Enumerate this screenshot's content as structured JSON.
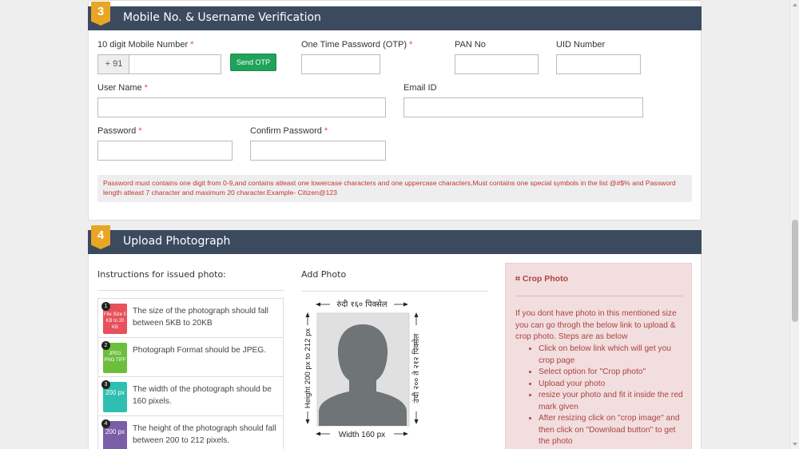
{
  "section3": {
    "number": "3",
    "title": "Mobile No. & Username Verification",
    "mobile_label": "10 digit Mobile Number",
    "mobile_prefix": "+ 91",
    "mobile_value": "",
    "send_otp_label": "Send OTP",
    "otp_label": "One Time Password (OTP)",
    "otp_value": "",
    "pan_label": "PAN No",
    "pan_value": "",
    "uid_label": "UID Number",
    "uid_value": "",
    "username_label": "User Name",
    "username_value": "",
    "email_label": "Email ID",
    "email_value": "",
    "password_label": "Password",
    "password_value": "",
    "confirm_label": "Confirm Password",
    "confirm_value": "",
    "required_mark": "*",
    "password_note": "Password must contains one digit from 0-9,and contains atleast one lowercase characters and one uppercase characters,Must contains one special symbols in the list @#$% and Password length atleast 7 character and maximum 20 character.Example- Citizen@123"
  },
  "section4": {
    "number": "4",
    "title": "Upload Photograph",
    "instructions_heading": "Instructions for issued photo:",
    "add_photo_heading": "Add Photo",
    "instructions": [
      {
        "num": "1",
        "icon": "file-size-icon",
        "icon_text": "File Size 5 KB to 20 KB",
        "color": "#e8505b",
        "text": "The size of the photograph should fall between 5KB to 20KB"
      },
      {
        "num": "2",
        "icon": "file-format-icon",
        "icon_text": "JPEG PNG TIFF",
        "color": "#6cbf3c",
        "text": "Photograph Format should be JPEG."
      },
      {
        "num": "3",
        "icon": "width-icon",
        "icon_text": "200 px",
        "color": "#2fbfb0",
        "text": "The width of the photograph should be 160 pixels."
      },
      {
        "num": "4",
        "icon": "height-icon",
        "icon_text": "200 px",
        "color": "#7b5ea8",
        "text": "The height of the photograph should fall between 200 to 212 pixels."
      }
    ],
    "photo_sample": {
      "top_label": "रुंदी १६० पिक्सेल",
      "bottom_label": "Width 160 px",
      "left_label": "Height 200 px to 212 px",
      "right_label": "उंची २०० ते २१२ पिक्सेल"
    },
    "crop": {
      "title": "Crop Photo",
      "intro": "If you dont have photo in this mentioned size you can go throgh the below link to upload & crop photo. Steps are as below",
      "steps": [
        "Click on below link which will get you crop page",
        "Select option for \"Crop photo\"",
        "Upload your photo",
        "resize your photo and fit it inside the red mark given",
        "After resizing click on \"crop image\" and then click on \"Download button\" to get the photo"
      ]
    }
  },
  "colors": {
    "header_bg": "#3b4a5e",
    "badge": "#e9a623",
    "otp_button": "#1fa35a",
    "note_text": "#c0392b",
    "crop_panel_bg": "#f2dede"
  }
}
